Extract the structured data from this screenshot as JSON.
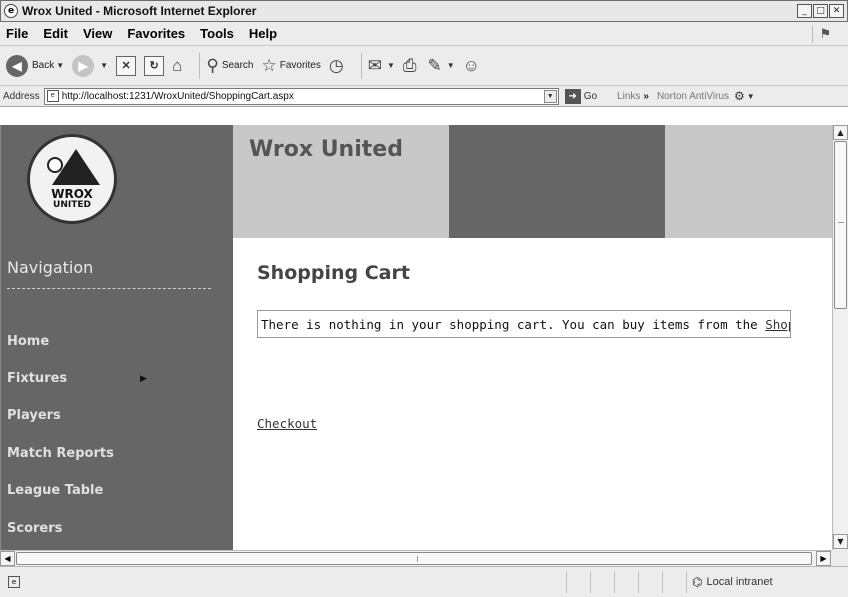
{
  "window": {
    "title": "Wrox United - Microsoft Internet Explorer",
    "controls": [
      "_",
      "□",
      "✕"
    ]
  },
  "menu": [
    "File",
    "Edit",
    "View",
    "Favorites",
    "Tools",
    "Help"
  ],
  "toolbar": {
    "back_label": "Back",
    "search_label": "Search",
    "favorites_label": "Favorites"
  },
  "addressbar": {
    "label": "Address",
    "url": "http://localhost:1231/WroxUnited/ShoppingCart.aspx",
    "go_label": "Go",
    "links_label": "Links",
    "norton_label": "Norton AntiVirus"
  },
  "site": {
    "title": "Wrox United",
    "logo_line1": "WROX",
    "logo_line2": "UNITED"
  },
  "nav": {
    "title": "Navigation",
    "items": [
      "Home",
      "Fixtures",
      "Players",
      "Match Reports",
      "League Table",
      "Scorers"
    ]
  },
  "main": {
    "title": "Shopping Cart",
    "message": "There is nothing in your shopping cart. You can buy items from the ",
    "shop_link": "Shop",
    "message_end": ".",
    "checkout": "Checkout"
  },
  "statusbar": {
    "zone": "Local intranet"
  }
}
